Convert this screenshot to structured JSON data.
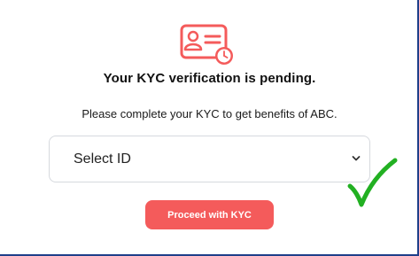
{
  "title": "Your KYC verification is pending.",
  "subtitle": "Please complete your KYC to get benefits of ABC.",
  "id_select": {
    "selected_label": "Select ID",
    "options": [
      "Select ID"
    ]
  },
  "proceed_button": {
    "label": "Proceed with KYC"
  },
  "icons": {
    "header": "id-card-clock-icon",
    "dropdown": "chevron-down-icon",
    "status": "checkmark-icon"
  },
  "colors": {
    "accent": "#f45b5b",
    "check": "#22b022",
    "frame": "#1f3f8a"
  }
}
